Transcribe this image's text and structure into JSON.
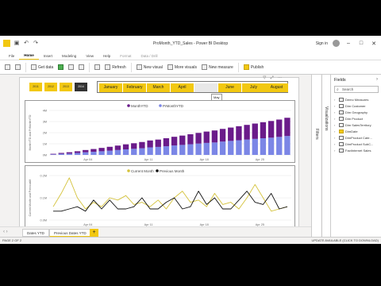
{
  "titlebar": {
    "title": "ProMonth_YTD_Sales - Power BI Desktop",
    "sign_in": "Sign in"
  },
  "ribbon": {
    "tabs": [
      "File",
      "Home",
      "Insert",
      "Modeling",
      "View",
      "Help",
      "Format",
      "Data / Drill"
    ],
    "active_tab": "Home",
    "items": [
      "Get data",
      "Refresh",
      "New visual",
      "More visuals",
      "New measure",
      "Publish"
    ]
  },
  "slicer": {
    "years": [
      "2011",
      "2012",
      "2013",
      "2014"
    ],
    "selected_year": "2014",
    "months": [
      "January",
      "February",
      "March",
      "April",
      "",
      "June",
      "July",
      "August"
    ],
    "tooltip": "May"
  },
  "colors": {
    "accent": "#f2c811",
    "month_ytd": "#6a1b8a",
    "pr_month_ytd": "#7b86e6",
    "current_month": "#d4c23a",
    "previous_month": "#111111"
  },
  "chart_data": [
    {
      "type": "bar",
      "stacked": true,
      "legend": [
        "MonthYTD",
        "PrMonthYTD"
      ],
      "ylabel": "MonthYTD and PrMonthYTD",
      "y_ticks": [
        "4M",
        "3M",
        "2M",
        "1M",
        "0M"
      ],
      "ylim": [
        0,
        4
      ],
      "x_ticks": [
        "Apr 04",
        "Apr 11",
        "Apr 18",
        "Apr 25"
      ],
      "series": [
        {
          "name": "PrMonthYTD",
          "values": [
            0.05,
            0.1,
            0.12,
            0.18,
            0.24,
            0.28,
            0.33,
            0.38,
            0.44,
            0.5,
            0.55,
            0.6,
            0.68,
            0.72,
            0.78,
            0.85,
            0.9,
            0.96,
            1.02,
            1.08,
            1.12,
            1.2,
            1.26,
            1.32,
            1.38,
            1.44,
            1.5,
            1.55,
            1.62,
            1.7
          ]
        },
        {
          "name": "MonthYTD",
          "values": [
            0.05,
            0.08,
            0.12,
            0.15,
            0.2,
            0.25,
            0.3,
            0.35,
            0.4,
            0.45,
            0.5,
            0.56,
            0.62,
            0.66,
            0.72,
            0.78,
            0.84,
            0.9,
            0.96,
            1.02,
            1.08,
            1.14,
            1.2,
            1.26,
            1.32,
            1.38,
            1.44,
            1.5,
            1.56,
            1.64
          ]
        }
      ]
    },
    {
      "type": "line",
      "legend": [
        "Current Month",
        "Previous Month"
      ],
      "ylabel": "Current Month and PreviousM",
      "y_ticks": [
        "0.2M",
        "0.1M",
        "0.0M"
      ],
      "ylim": [
        0,
        0.2
      ],
      "x_ticks": [
        "Apr 04",
        "Apr 11",
        "Apr 18",
        "Apr 25"
      ],
      "series": [
        {
          "name": "Current Month",
          "values": [
            0.06,
            0.12,
            0.19,
            0.1,
            0.05,
            0.08,
            0.06,
            0.1,
            0.09,
            0.11,
            0.07,
            0.08,
            0.06,
            0.09,
            0.05,
            0.1,
            0.13,
            0.08,
            0.09,
            0.06,
            0.12,
            0.07,
            0.08,
            0.05,
            0.1,
            0.16,
            0.1,
            0.04,
            0.05,
            0.06
          ]
        },
        {
          "name": "Previous Month",
          "values": [
            0.04,
            0.04,
            0.05,
            0.06,
            0.04,
            0.09,
            0.05,
            0.09,
            0.05,
            0.05,
            0.06,
            0.1,
            0.05,
            0.05,
            0.08,
            0.1,
            0.05,
            0.06,
            0.13,
            0.07,
            0.1,
            0.05,
            0.05,
            0.09,
            0.13,
            0.08,
            0.07,
            0.12,
            0.05,
            0.06
          ]
        }
      ]
    }
  ],
  "panes": {
    "filters": "Filters",
    "visualizations": "Visualizations",
    "fields_title": "Fields",
    "search_placeholder": "Search",
    "fields": [
      "Demo Measures",
      "Dim Customer",
      "Dim Geography",
      "Dim Product",
      "Dim SalesTerritory",
      "DimDate",
      "DimProduct Cate...",
      "DimProduct SubC...",
      "FactInternet Sales"
    ]
  },
  "pages": {
    "tabs": [
      "Dates YTD",
      "Previous Dates YTD"
    ],
    "active": "Previous Dates YTD",
    "add": "+"
  },
  "status": {
    "left": "PAGE 2 OF 2",
    "right": "UPDATE AVAILABLE (CLICK TO DOWNLOAD)"
  }
}
